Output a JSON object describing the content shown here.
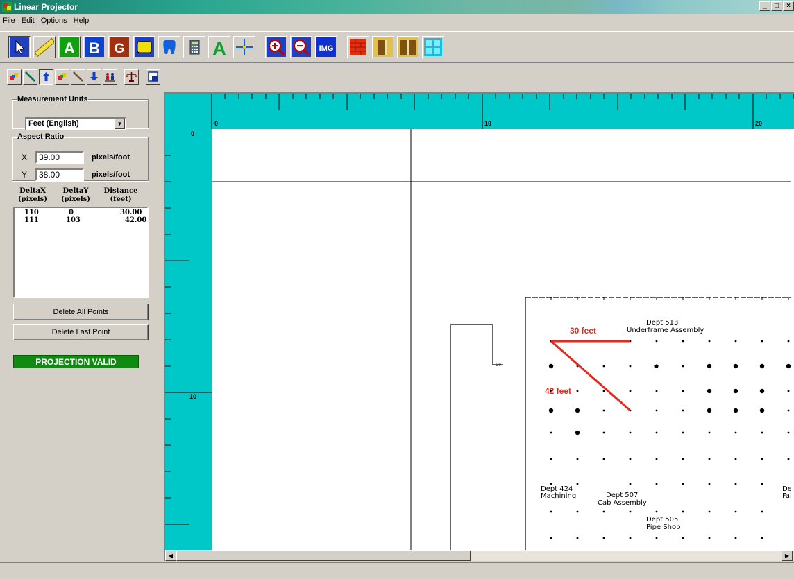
{
  "window": {
    "title": "Linear Projector",
    "minimize": "_",
    "maximize": "□",
    "close": "×"
  },
  "menu": [
    {
      "label": "File",
      "accel": "F",
      "rest": "ile"
    },
    {
      "label": "Edit",
      "accel": "E",
      "rest": "dit"
    },
    {
      "label": "Options",
      "accel": "O",
      "rest": "ptions"
    },
    {
      "label": "Help",
      "accel": "H",
      "rest": "elp"
    }
  ],
  "toolbar": {
    "text_a": "A",
    "text_b": "B",
    "text_g": "G",
    "text_green_a": "A",
    "img_label": "IMG"
  },
  "measurement_units": {
    "legend": "Measurement Units",
    "selected": "Feet (English)",
    "arrow": "▼"
  },
  "aspect_ratio": {
    "legend": "Aspect Ratio",
    "x_label": "X",
    "x_value": "39.00",
    "y_label": "Y",
    "y_value": "38.00",
    "unit": "pixels/foot"
  },
  "table": {
    "headers": [
      {
        "line1": "DeltaX",
        "line2": "(pixels)"
      },
      {
        "line1": "DeltaY",
        "line2": "(pixels)"
      },
      {
        "line1": "Distance",
        "line2": "(feet)"
      }
    ],
    "rows": [
      {
        "dx": "110",
        "dy": "0",
        "dist": "30.00"
      },
      {
        "dx": "111",
        "dy": "103",
        "dist": "42.00"
      }
    ]
  },
  "buttons": {
    "delete_all": "Delete All Points",
    "delete_last": "Delete Last Point"
  },
  "status": {
    "projection": "PROJECTION VALID"
  },
  "ruler": {
    "top_labels": [
      "0",
      "10",
      "20"
    ],
    "left_labels": [
      "0",
      "10"
    ]
  },
  "floorplan": {
    "label_30": "30 feet",
    "label_42": "42 feet",
    "dept_513": "Dept 513",
    "dept_513_name": "Underframe Assembly",
    "dept_424": "Dept 424",
    "dept_424_name": "Machining",
    "dept_507": "Dept 507",
    "dept_507_name": "Cab Assembly",
    "dept_505": "Dept 505",
    "dept_505_name": "Pipe Shop",
    "dept_partial": "De",
    "dept_partial_name": "Fab"
  },
  "colors": {
    "ruler": "#00c8c8",
    "measure_line": "#e8281c",
    "valid_badge": "#108a10",
    "selection_accent": "#0000a0"
  }
}
